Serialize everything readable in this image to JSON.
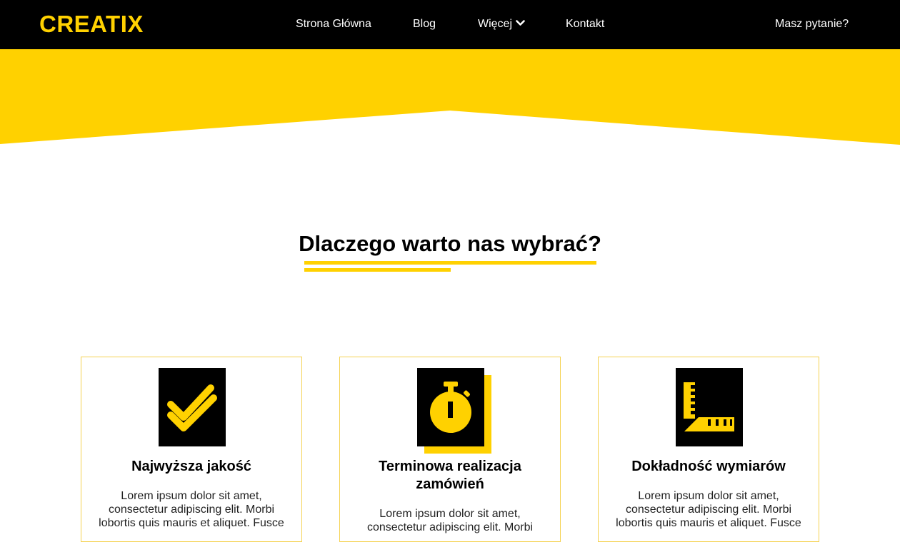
{
  "header": {
    "logo": "CREATIX",
    "nav": {
      "home": "Strona Główna",
      "blog": "Blog",
      "more": "Więcej",
      "contact": "Kontakt"
    },
    "question_link": "Masz pytanie?"
  },
  "section": {
    "title": "Dlaczego warto nas wybrać?"
  },
  "cards": [
    {
      "icon": "double-check-icon",
      "title": "Najwyższa jakość",
      "text": "Lorem ipsum dolor sit amet, consectetur adipiscing elit. Morbi lobortis quis mauris et aliquet. Fusce"
    },
    {
      "icon": "stopwatch-icon",
      "title": "Terminowa realizacja zamówień",
      "text": "Lorem ipsum dolor sit amet, consectetur adipiscing elit. Morbi"
    },
    {
      "icon": "ruler-icon",
      "title": "Dokładność wymiarów",
      "text": "Lorem ipsum dolor sit amet, consectetur adipiscing elit. Morbi lobortis quis mauris et aliquet. Fusce"
    }
  ],
  "colors": {
    "accent": "#ffd100",
    "header_bg": "#000000",
    "card_border": "#f5d251"
  }
}
